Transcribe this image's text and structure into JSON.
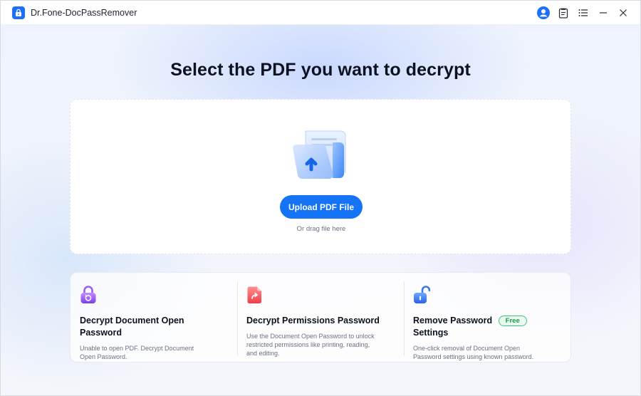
{
  "window": {
    "title": "Dr.Fone-DocPassRemover",
    "app_icon": "lock-file-icon",
    "controls": [
      {
        "name": "account-icon"
      },
      {
        "name": "feedback-icon"
      },
      {
        "name": "menu-icon"
      },
      {
        "name": "minimize-icon"
      },
      {
        "name": "close-icon"
      }
    ]
  },
  "main": {
    "title": "Select the PDF you want to decrypt",
    "upload": {
      "button_label": "Upload PDF File",
      "hint": "Or drag file here"
    },
    "features": [
      {
        "icon": "purple-lock-icon",
        "title": "Decrypt Document Open Password",
        "description": "Unable to open PDF. Decrypt Document Open Password."
      },
      {
        "icon": "red-file-share-icon",
        "title": "Decrypt Permissions Password",
        "description": "Use the Document Open Password to unlock restricted permissions like printing, reading, and editing."
      },
      {
        "icon": "blue-unlock-icon",
        "title": "Remove Password Settings",
        "badge": "Free",
        "description": "One-click removal of Document Open Password settings using known password."
      }
    ]
  },
  "colors": {
    "accent": "#1474f5",
    "free_badge": "#1d9b4f"
  }
}
